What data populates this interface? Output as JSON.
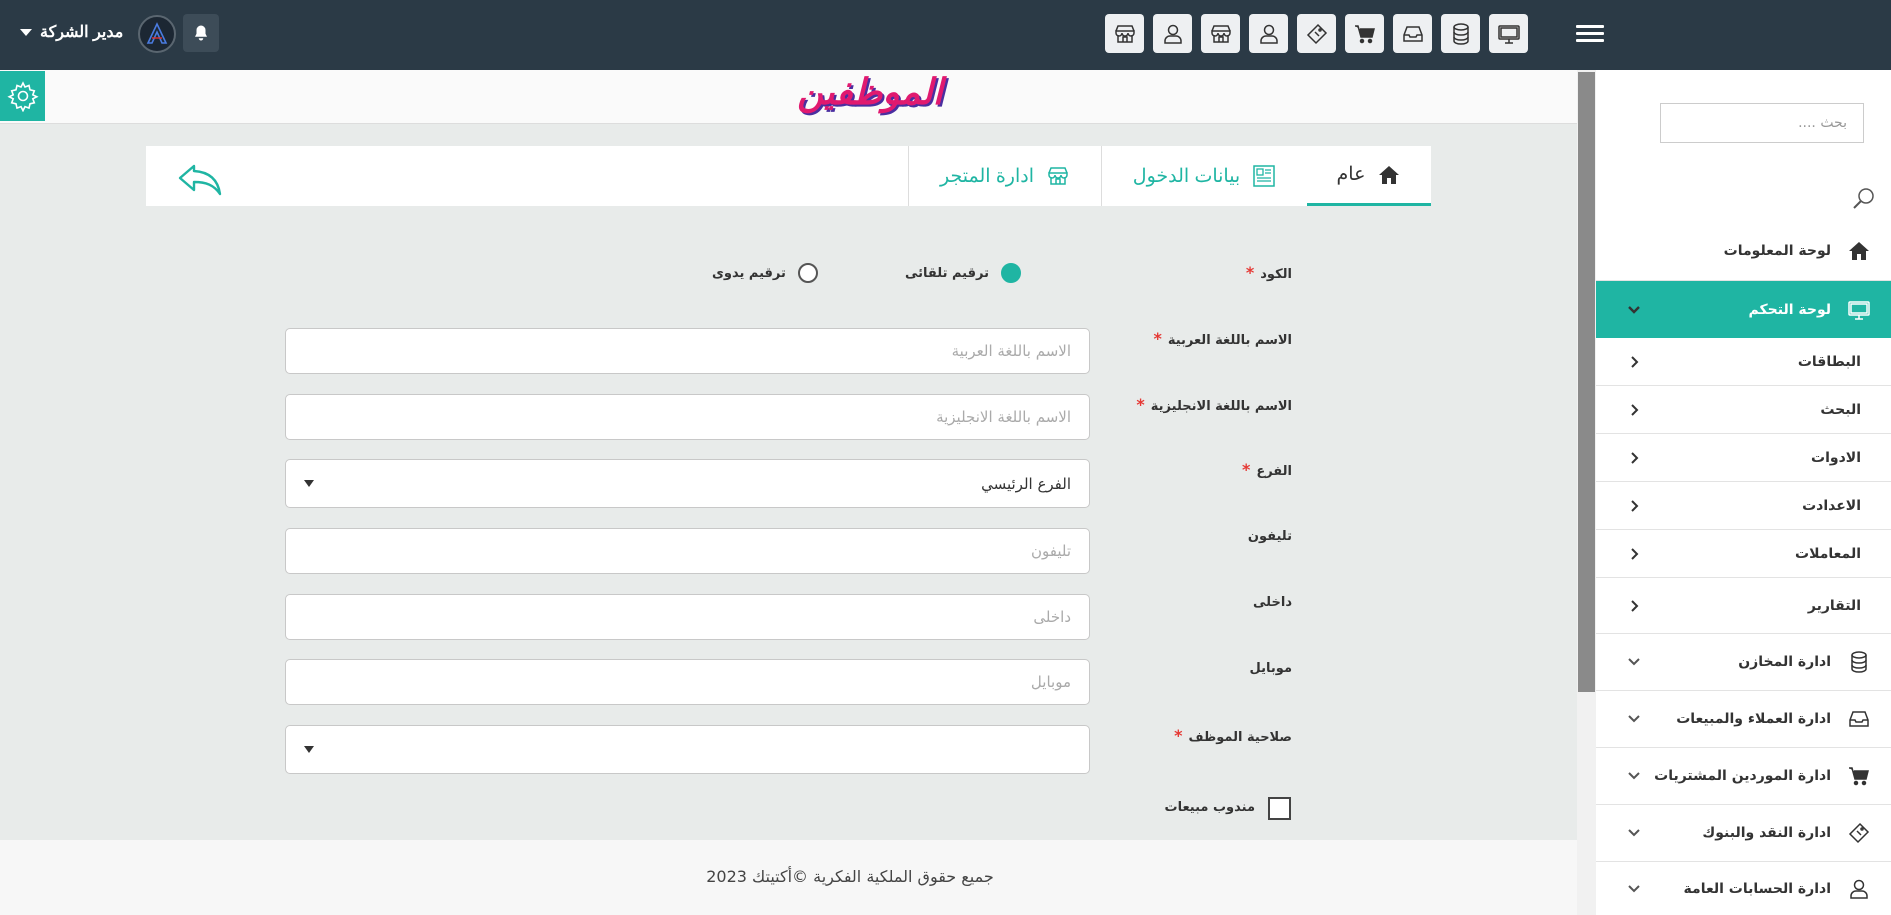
{
  "topbar": {
    "user_name": "مدير الشركة",
    "icons": [
      "store-icon",
      "user-icon",
      "store-icon",
      "user-icon",
      "ticket-icon",
      "cart-icon",
      "inbox-icon",
      "database-icon",
      "monitor-icon"
    ]
  },
  "page": {
    "title": "الموظفين"
  },
  "tabs": [
    {
      "label": "عام",
      "icon": "home-icon"
    },
    {
      "label": "بيانات الدخول",
      "icon": "id-card-icon"
    },
    {
      "label": "ادارة المتجر",
      "icon": "store-icon"
    }
  ],
  "form": {
    "code_label": "الكود",
    "radio_auto": "ترقيم تلقائى",
    "radio_manual": "ترقيم يدوى",
    "name_ar_label": "الاسم باللغة العربية",
    "name_ar_placeholder": "الاسم باللغة العربية",
    "name_en_label": "الاسم باللغة الانجليزية",
    "name_en_placeholder": "الاسم باللغة الانجليزية",
    "branch_label": "الفرع",
    "branch_value": "الفرع الرئيسي",
    "phone_label": "تليفون",
    "phone_placeholder": "تليفون",
    "ext_label": "داخلى",
    "ext_placeholder": "داخلى",
    "mobile_label": "موبايل",
    "mobile_placeholder": "موبايل",
    "role_label": "صلاحية الموظف",
    "role_value": "",
    "sales_rep_label": "مندوب مبيعات",
    "required_mark": "*"
  },
  "footer": {
    "text": "جميع حقوق الملكية الفكرية ©أكتيتك 2023"
  },
  "sidebar": {
    "search_placeholder": "بحث ....",
    "items": [
      {
        "label": "لوحة المعلومات",
        "icon": "home-icon"
      },
      {
        "label": "لوحة التحكم",
        "icon": "monitor-icon",
        "active": true
      },
      {
        "label": "البطاقات",
        "sub": true
      },
      {
        "label": "البحث",
        "sub": true
      },
      {
        "label": "الادوات",
        "sub": true
      },
      {
        "label": "الاعدادت",
        "sub": true
      },
      {
        "label": "المعاملات",
        "sub": true
      },
      {
        "label": "التقارير",
        "sub": true
      },
      {
        "label": "ادارة المخازن",
        "icon": "database-icon"
      },
      {
        "label": "ادارة العملاء والمبيعات",
        "icon": "inbox-icon"
      },
      {
        "label": "ادارة الموردين المشتريات",
        "icon": "cart-icon"
      },
      {
        "label": "ادارة النقد والبنوك",
        "icon": "ticket-icon"
      },
      {
        "label": "ادارة الحسابات العامة",
        "icon": "user-icon"
      }
    ]
  },
  "colors": {
    "accent": "#1fb5a3",
    "topbar": "#2b3a46",
    "required": "#e53935",
    "title": "#e0196f"
  }
}
